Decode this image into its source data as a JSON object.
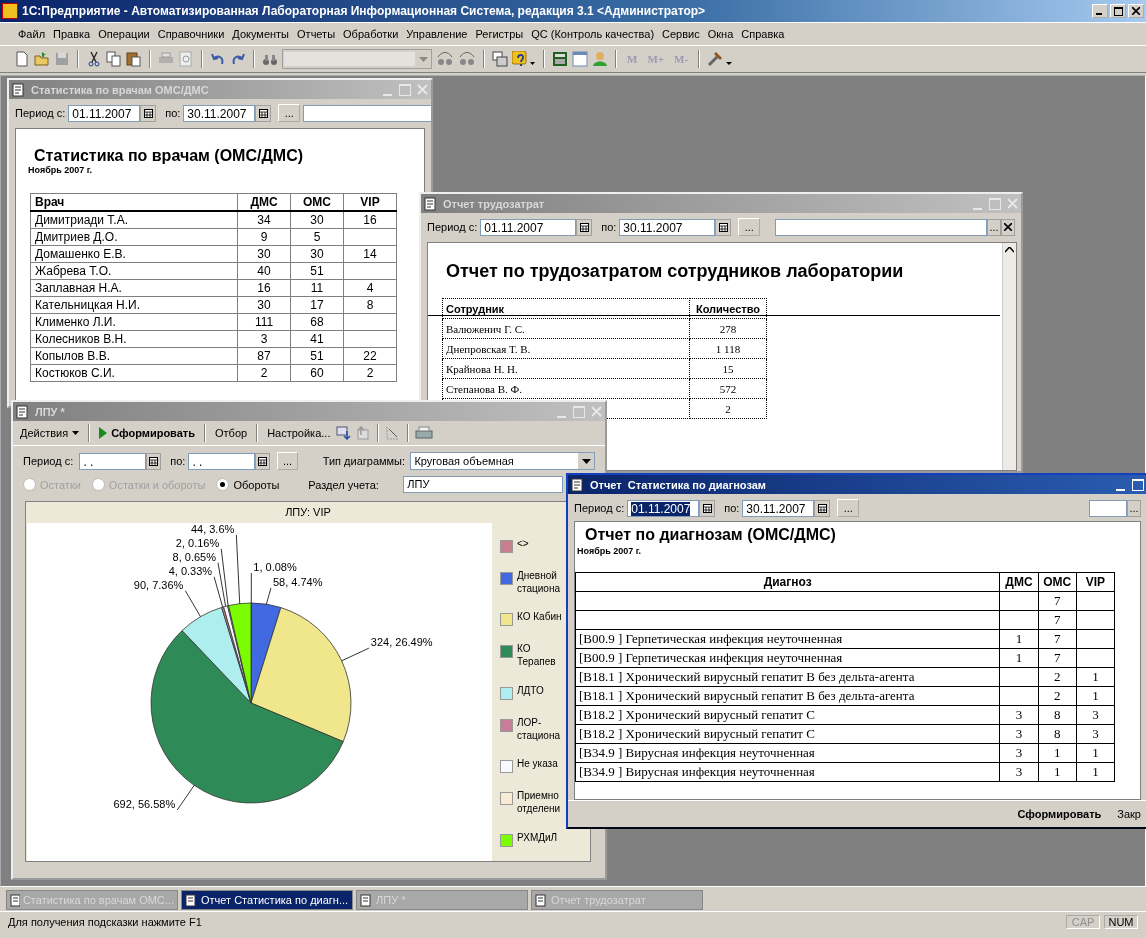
{
  "app": {
    "title": "1С:Предприятие - Автоматизированная Лабораторная Информационная Система, редакция 3.1 <Администратор>"
  },
  "menu": [
    "Файл",
    "Правка",
    "Операции",
    "Справочники",
    "Документы",
    "Отчеты",
    "Обработки",
    "Управление",
    "Регистры",
    "QC (Контроль качества)",
    "Сервис",
    "Окна",
    "Справка"
  ],
  "toolbar": {
    "memory_buttons": [
      "M",
      "M+",
      "M-"
    ]
  },
  "doctors_window": {
    "title": "Статистика по врачам ОМС/ДМС",
    "active": false,
    "period": {
      "label": "Период с:",
      "from": "01.11.2007",
      "to_label": "по:",
      "to": "30.11.2007",
      "more": "..."
    },
    "report": {
      "title": "Статистика по врачам (ОМС/ДМС)",
      "subtitle": "Ноябрь 2007 г.",
      "columns": [
        "Врач",
        "ДМС",
        "ОМС",
        "VIP"
      ],
      "rows": [
        {
          "name": "Димитриади Т.А.",
          "dms": "34",
          "oms": "30",
          "vip": "16"
        },
        {
          "name": "Дмитриев Д.О.",
          "dms": "9",
          "oms": "5"
        },
        {
          "name": "Домашенко Е.В.",
          "dms": "30",
          "oms": "30",
          "vip": "14"
        },
        {
          "name": "Жабрева Т.О.",
          "dms": "40",
          "oms": "51"
        },
        {
          "name": "Заплавная Н.А.",
          "dms": "16",
          "oms": "11",
          "vip": "4"
        },
        {
          "name": "Катeльницкая Н.И.",
          "dms": "30",
          "oms": "17",
          "vip": "8"
        },
        {
          "name": "Клименко Л.И.",
          "dms": "111",
          "oms": "68"
        },
        {
          "name": "Колесников В.Н.",
          "dms": "3",
          "oms": "41"
        },
        {
          "name": "Копылов В.В.",
          "dms": "87",
          "oms": "51",
          "vip": "22"
        },
        {
          "name": "Костюков С.И.",
          "dms": "2",
          "oms": "60",
          "vip": "2"
        }
      ]
    }
  },
  "labor_window": {
    "title": "Отчет трудозатрат",
    "active": false,
    "period": {
      "label": "Период с:",
      "from": "01.11.2007",
      "to_label": "по:",
      "to": "30.11.2007",
      "more": "...",
      "extra_more": "..."
    },
    "report": {
      "title": "Отчет по трудозатратом сотрудников лаборатории",
      "columns": [
        "Сотрудник",
        "Количество"
      ],
      "rows": [
        {
          "name": "Валюженич Г. С.",
          "count": "278"
        },
        {
          "name": "Днепровская Т. В.",
          "count": "1 118"
        },
        {
          "name": "Крайнова Н. Н.",
          "count": "15"
        },
        {
          "name": "Степанова В. Ф.",
          "count": "572"
        },
        {
          "count": "2"
        }
      ]
    }
  },
  "lpu_window": {
    "title": "ЛПУ *",
    "active": false,
    "toolbar": {
      "actions": "Действия",
      "generate": "Сформировать",
      "filter": "Отбор",
      "settings": "Настройка..."
    },
    "form": {
      "period_label": "Период с:",
      "from": ". .",
      "to_label": "по:",
      "to": ". .",
      "more": "...",
      "chart_type_label": "Тип диаграммы:",
      "chart_type": "Круговая объемная",
      "section_label": "Раздел учета:",
      "section": "ЛПУ",
      "radios": [
        {
          "label": "Остатки",
          "selected": false,
          "disabled": true
        },
        {
          "label": "Остатки и обороты",
          "selected": false,
          "disabled": true
        },
        {
          "label": "Обороты",
          "selected": true,
          "disabled": false
        }
      ]
    },
    "chart_data": {
      "type": "pie",
      "title": "ЛПУ: VIP",
      "categories": [
        "<>",
        "Дневной стациона",
        "КО Кабин",
        "КО Терапев",
        "ЛДТО",
        "ЛОР-стациона",
        "Не указа",
        "Приемно отделени",
        "РХМДиЛ"
      ],
      "values": [
        1,
        58,
        324,
        692,
        90,
        4,
        8,
        2,
        44
      ],
      "colors": [
        "#c8808e",
        "#4169e1",
        "#f0e68c",
        "#2e8b57",
        "#afeeee",
        "#c77c9a",
        "#f8f8ff",
        "#faebd7",
        "#7cfc00"
      ],
      "data_labels": true,
      "value_labels": [
        "1, 0.08%",
        "58, 4.74%",
        "324, 26.49%",
        "692, 56.58%",
        "90, 7.36%",
        "4, 0.33%",
        "8, 0.65%",
        "2, 0.16%",
        "44, 3.6%"
      ]
    }
  },
  "diagnoses_window": {
    "title": "Отчет  Статистика по диагнозам",
    "active": true,
    "period": {
      "label": "Период с:",
      "from": "01.11.2007",
      "from_selected": true,
      "to_label": "по:",
      "to": "30.11.2007",
      "more": "...",
      "extra_more": "..."
    },
    "report": {
      "title": "Отчет по диагнозам (ОМС/ДМС)",
      "subtitle": "Ноябрь 2007 г.",
      "columns": [
        "Диагноз",
        "ДМС",
        "ОМС",
        "VIP"
      ],
      "rows": [
        {
          "oms": "7"
        },
        {
          "oms": "7"
        },
        {
          "diagnosis": "[B00.9 ] Герпетическая инфекция неуточненная",
          "dms": "1",
          "oms": "7"
        },
        {
          "diagnosis": "[B00.9 ] Герпетическая инфекция неуточненная",
          "dms": "1",
          "oms": "7"
        },
        {
          "diagnosis": "[B18.1 ] Хронический  вирусный гепатит B без дельта-агента",
          "oms": "2",
          "vip": "1"
        },
        {
          "diagnosis": "[B18.1 ] Хронический  вирусный гепатит B без дельта-агента",
          "oms": "2",
          "vip": "1"
        },
        {
          "diagnosis": "[B18.2 ] Хронический вирусный гепатит C",
          "dms": "3",
          "oms": "8",
          "vip": "3"
        },
        {
          "diagnosis": "[B18.2 ] Хронический вирусный гепатит C",
          "dms": "3",
          "oms": "8",
          "vip": "3"
        },
        {
          "diagnosis": "[B34.9 ] Вирусная инфекция неуточненная",
          "dms": "3",
          "oms": "1",
          "vip": "1"
        },
        {
          "diagnosis": "[B34.9 ] Вирусная инфекция неуточненная",
          "dms": "3",
          "oms": "1",
          "vip": "1"
        }
      ]
    },
    "footer": {
      "generate": "Сформировать",
      "close": "Закр"
    }
  },
  "taskbar": [
    {
      "label": "Статистика по врачам ОМС...",
      "selected": false
    },
    {
      "label": "Отчет  Статистика по диагн...",
      "selected": true
    },
    {
      "label": "ЛПУ *",
      "selected": false
    },
    {
      "label": "Отчет трудозатрат",
      "selected": false
    }
  ],
  "status_bar": {
    "hint": "Для получения подсказки нажмите F1",
    "indicators": [
      {
        "label": "CAP",
        "on": false
      },
      {
        "label": "NUM",
        "on": true
      }
    ]
  }
}
